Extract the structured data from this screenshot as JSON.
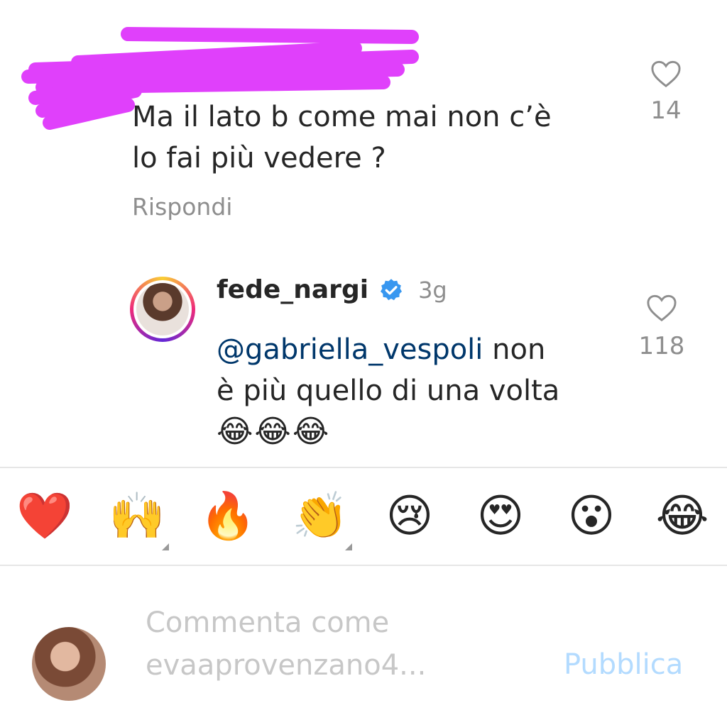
{
  "comment": {
    "text_line1": "Ma il lato b come mai non c’è",
    "text_line2": "lo fai più vedere ?",
    "likes": "14",
    "reply_label": "Rispondi"
  },
  "reply": {
    "username": "fede_nargi",
    "time": "3g",
    "mention": "@gabriella_vespoli",
    "text_after_mention": " non",
    "text_line2": "è più quello di una volta",
    "emojis": "😂😂😂",
    "likes": "118"
  },
  "reactions": [
    {
      "name": "red-heart",
      "glyph": "❤️",
      "has_variants": false
    },
    {
      "name": "raising-hands",
      "glyph": "🙌",
      "has_variants": true
    },
    {
      "name": "fire",
      "glyph": "🔥",
      "has_variants": false
    },
    {
      "name": "clapping-hands",
      "glyph": "👏",
      "has_variants": true
    },
    {
      "name": "crying-face",
      "glyph": "😢",
      "has_variants": false
    },
    {
      "name": "heart-eyes",
      "glyph": "😍",
      "has_variants": false
    },
    {
      "name": "surprised-face",
      "glyph": "😮",
      "has_variants": false
    },
    {
      "name": "tears-of-joy",
      "glyph": "😂",
      "has_variants": false
    }
  ],
  "composer": {
    "placeholder": "Commenta come evaaprovenzano4...",
    "placeholder_line1": "Commenta come",
    "placeholder_line2": "evaaprovenzano4...",
    "publish_label": "Pubblica"
  },
  "colors": {
    "scribble": "#e040fb",
    "verified": "#3897f0",
    "mention": "#00376b",
    "publish_disabled": "#b3dbff"
  }
}
